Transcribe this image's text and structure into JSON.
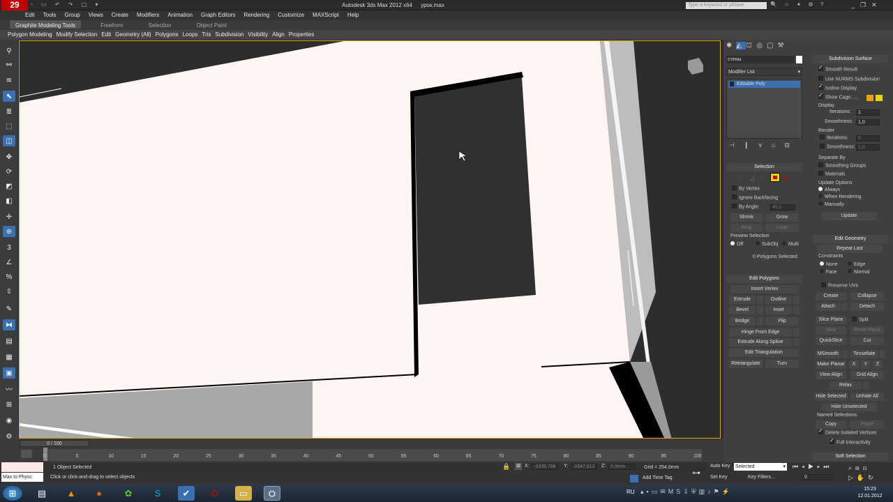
{
  "title": {
    "app": "Autodesk 3ds Max  2012 x64",
    "file": "урок.max",
    "search_placeholder": "Type a keyword or phrase"
  },
  "menu": [
    "Edit",
    "Tools",
    "Group",
    "Views",
    "Create",
    "Modifiers",
    "Animation",
    "Graph Editors",
    "Rendering",
    "Customize",
    "MAXScript",
    "Help"
  ],
  "ribbon": {
    "tabs": [
      "Graphite Modeling Tools",
      "Freeform",
      "Selection",
      "Object Paint"
    ],
    "panels": [
      "Polygon Modeling",
      "Modify Selection",
      "Edit",
      "Geometry (All)",
      "Polygons",
      "Loops",
      "Tris",
      "Subdivision",
      "Visibility",
      "Align",
      "Properties"
    ]
  },
  "colors": {
    "accent": "#3a6fb0",
    "viewport_border": "#e0a000",
    "swatch_orange": "#f0a000",
    "swatch_yellow": "#e6d800",
    "swatch_red": "#d00000"
  },
  "cmd": {
    "object_name": "стены",
    "modifier_list": "Modifier List",
    "stack_item": "Editable Poly",
    "selection": {
      "title": "Selection",
      "by_vertex": "By Vertex",
      "ignore_backfacing": "Ignore Backfacing",
      "by_angle": "By Angle:",
      "by_angle_value": "45,0",
      "shrink": "Shrink",
      "grow": "Grow",
      "ring": "Ring",
      "loop": "Loop",
      "preview_selection": "Preview Selection",
      "preview_off": "Off",
      "preview_subobj": "SubObj",
      "preview_multi": "Multi",
      "status": "0 Polygons Selected"
    },
    "edit_polygons": {
      "title": "Edit Polygons",
      "insert_vertex": "Insert Vertex",
      "extrude": "Extrude",
      "outline": "Outline",
      "bevel": "Bevel",
      "inset": "Inset",
      "bridge": "Bridge",
      "flip": "Flip",
      "hinge": "Hinge From Edge",
      "extrude_spline": "Extrude Along Spline",
      "edit_tri": "Edit Triangulation",
      "retriangulate": "Retriangulate",
      "turn": "Turn"
    },
    "subdivision": {
      "title": "Subdivision Surface",
      "smooth_result": "Smooth Result",
      "use_nurms": "Use NURMS Subdivision",
      "isoline": "Isoline Display",
      "show_cage": "Show Cage......",
      "display": "Display",
      "iterations": "Iterations:",
      "iterations_value": "1",
      "smoothness": "Smoothness:",
      "smoothness_value": "1,0",
      "render": "Render",
      "r_iterations_value": "0",
      "r_smoothness_value": "1,0",
      "separate_by": "Separate By",
      "smoothing_groups": "Smoothing Groups",
      "materials": "Materials",
      "update_options": "Update Options",
      "always": "Always",
      "when_rendering": "When Rendering",
      "manually": "Manually",
      "update": "Update"
    },
    "edit_geometry": {
      "title": "Edit Geometry",
      "repeat_last": "Repeat Last",
      "constraints": "Constraints",
      "none": "None",
      "edge": "Edge",
      "face": "Face",
      "normal": "Normal",
      "preserve_uvs": "Preserve UVs",
      "create": "Create",
      "collapse": "Collapse",
      "attach": "Attach",
      "detach": "Detach",
      "slice_plane": "Slice Plane",
      "split": "Split",
      "slice": "Slice",
      "reset_plane": "Reset Plane",
      "quickslice": "QuickSlice",
      "cut": "Cut",
      "msmooth": "MSmooth",
      "tessellate": "Tessellate",
      "make_planar": "Make Planar",
      "x": "X",
      "y": "Y",
      "z": "Z",
      "view_align": "View Align",
      "grid_align": "Grid Align",
      "relax": "Relax",
      "hide_selected": "Hide Selected",
      "unhide_all": "Unhide All",
      "hide_unselected": "Hide Unselected",
      "named_selections": "Named Selections:",
      "copy": "Copy",
      "paste": "Paste",
      "delete_isolated": "Delete Isolated Vertices",
      "full_interactivity": "Full Interactivity",
      "soft_selection": "Soft Selection"
    }
  },
  "timeline": {
    "slider": "0 / 100",
    "ticks": [
      "0",
      "5",
      "10",
      "15",
      "20",
      "25",
      "30",
      "35",
      "40",
      "45",
      "50",
      "55",
      "60",
      "65",
      "70",
      "75",
      "80",
      "85",
      "90",
      "95",
      "100"
    ]
  },
  "status": {
    "script_box": "Max to Physc",
    "objects_selected": "1 Object Selected",
    "prompt": "Click or click-and-drag to select objects",
    "x_label": "X:",
    "x_value": "-3339,768",
    "y_label": "Y:",
    "y_value": "-2647,913",
    "z_label": "Z:",
    "z_value": "0,0mm",
    "grid": "Grid = 254,0mm",
    "add_time_tag": "Add Time Tag",
    "auto_key": "Auto Key",
    "set_key": "Set Key",
    "key_mode": "Selected",
    "key_filters": "Key Filters...",
    "frame": "0"
  },
  "taskbar": {
    "lang": "RU",
    "time": "15:23",
    "date": "12.01.2012"
  }
}
